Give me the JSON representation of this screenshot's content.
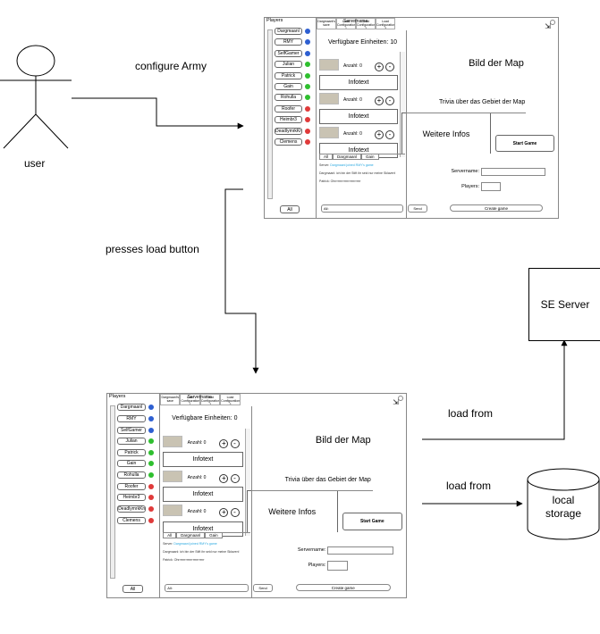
{
  "actor": {
    "label": "user"
  },
  "steps": {
    "configure": "configure Army",
    "load_button": "presses load button",
    "load_from_1": "load from",
    "load_from_2": "load from"
  },
  "server_box": {
    "label": "SE Server"
  },
  "storage": {
    "line1": "local",
    "line2": "storage"
  },
  "mockup": {
    "players_title": "Players",
    "players": [
      {
        "name": "Dargmaanl",
        "status_color": "#2e5fd1"
      },
      {
        "name": "RMY",
        "status_color": "#2e5fd1"
      },
      {
        "name": "SelfGamer",
        "status_color": "#2e5fd1"
      },
      {
        "name": "Julian",
        "status_color": "#2fbf2f"
      },
      {
        "name": "Patrick",
        "status_color": "#2fbf2f"
      },
      {
        "name": "Gain",
        "status_color": "#2fbf2f"
      },
      {
        "name": "Rohulla",
        "status_color": "#2fbf2f"
      },
      {
        "name": "Roofer",
        "status_color": "#e03a3a"
      },
      {
        "name": "Heimbr3",
        "status_color": "#e03a3a"
      },
      {
        "name": "DeadlymrkKnight",
        "status_color": "#e03a3a"
      },
      {
        "name": "Clemens",
        "status_color": "#e03a3a"
      }
    ],
    "all_button": "All",
    "server_name": "Servername",
    "tabs": [
      "Dargmaanl's save",
      "Load Configuration 1",
      "Load Configuration 2",
      "Load Configuration 3"
    ],
    "units_label_first": "Verfügbare Einheiten: 10",
    "units_label_second": "Verfügbare Einheiten: 0",
    "unit_count": "Anzahl: 0",
    "infotext": "Infotext",
    "plus": "+",
    "minus": "-",
    "chat_buttons": [
      "All",
      "Dargmaanl",
      "Gain"
    ],
    "chat_lines": [
      {
        "prefix": "Server: ",
        "text": "Dargmaanl joined RMY's game"
      },
      {
        "prefix": "",
        "text": "Dargmaanl: ich bin der Stift ihr seid nur meine Sklaven!"
      },
      {
        "prefix": "",
        "text": "Patrick: Ohrrrrrrrrrrrrrrrrrrrrrrrrr"
      }
    ],
    "chat_input": "All:",
    "send": "Send",
    "map_title": "Bild der Map",
    "trivia": "Trivia über das Gebiet der Map",
    "more_info": "Weitere Infos",
    "start_game": "Start Game",
    "servername_label": "Servername:",
    "players_label": "Players:",
    "create_game": "Create game"
  }
}
